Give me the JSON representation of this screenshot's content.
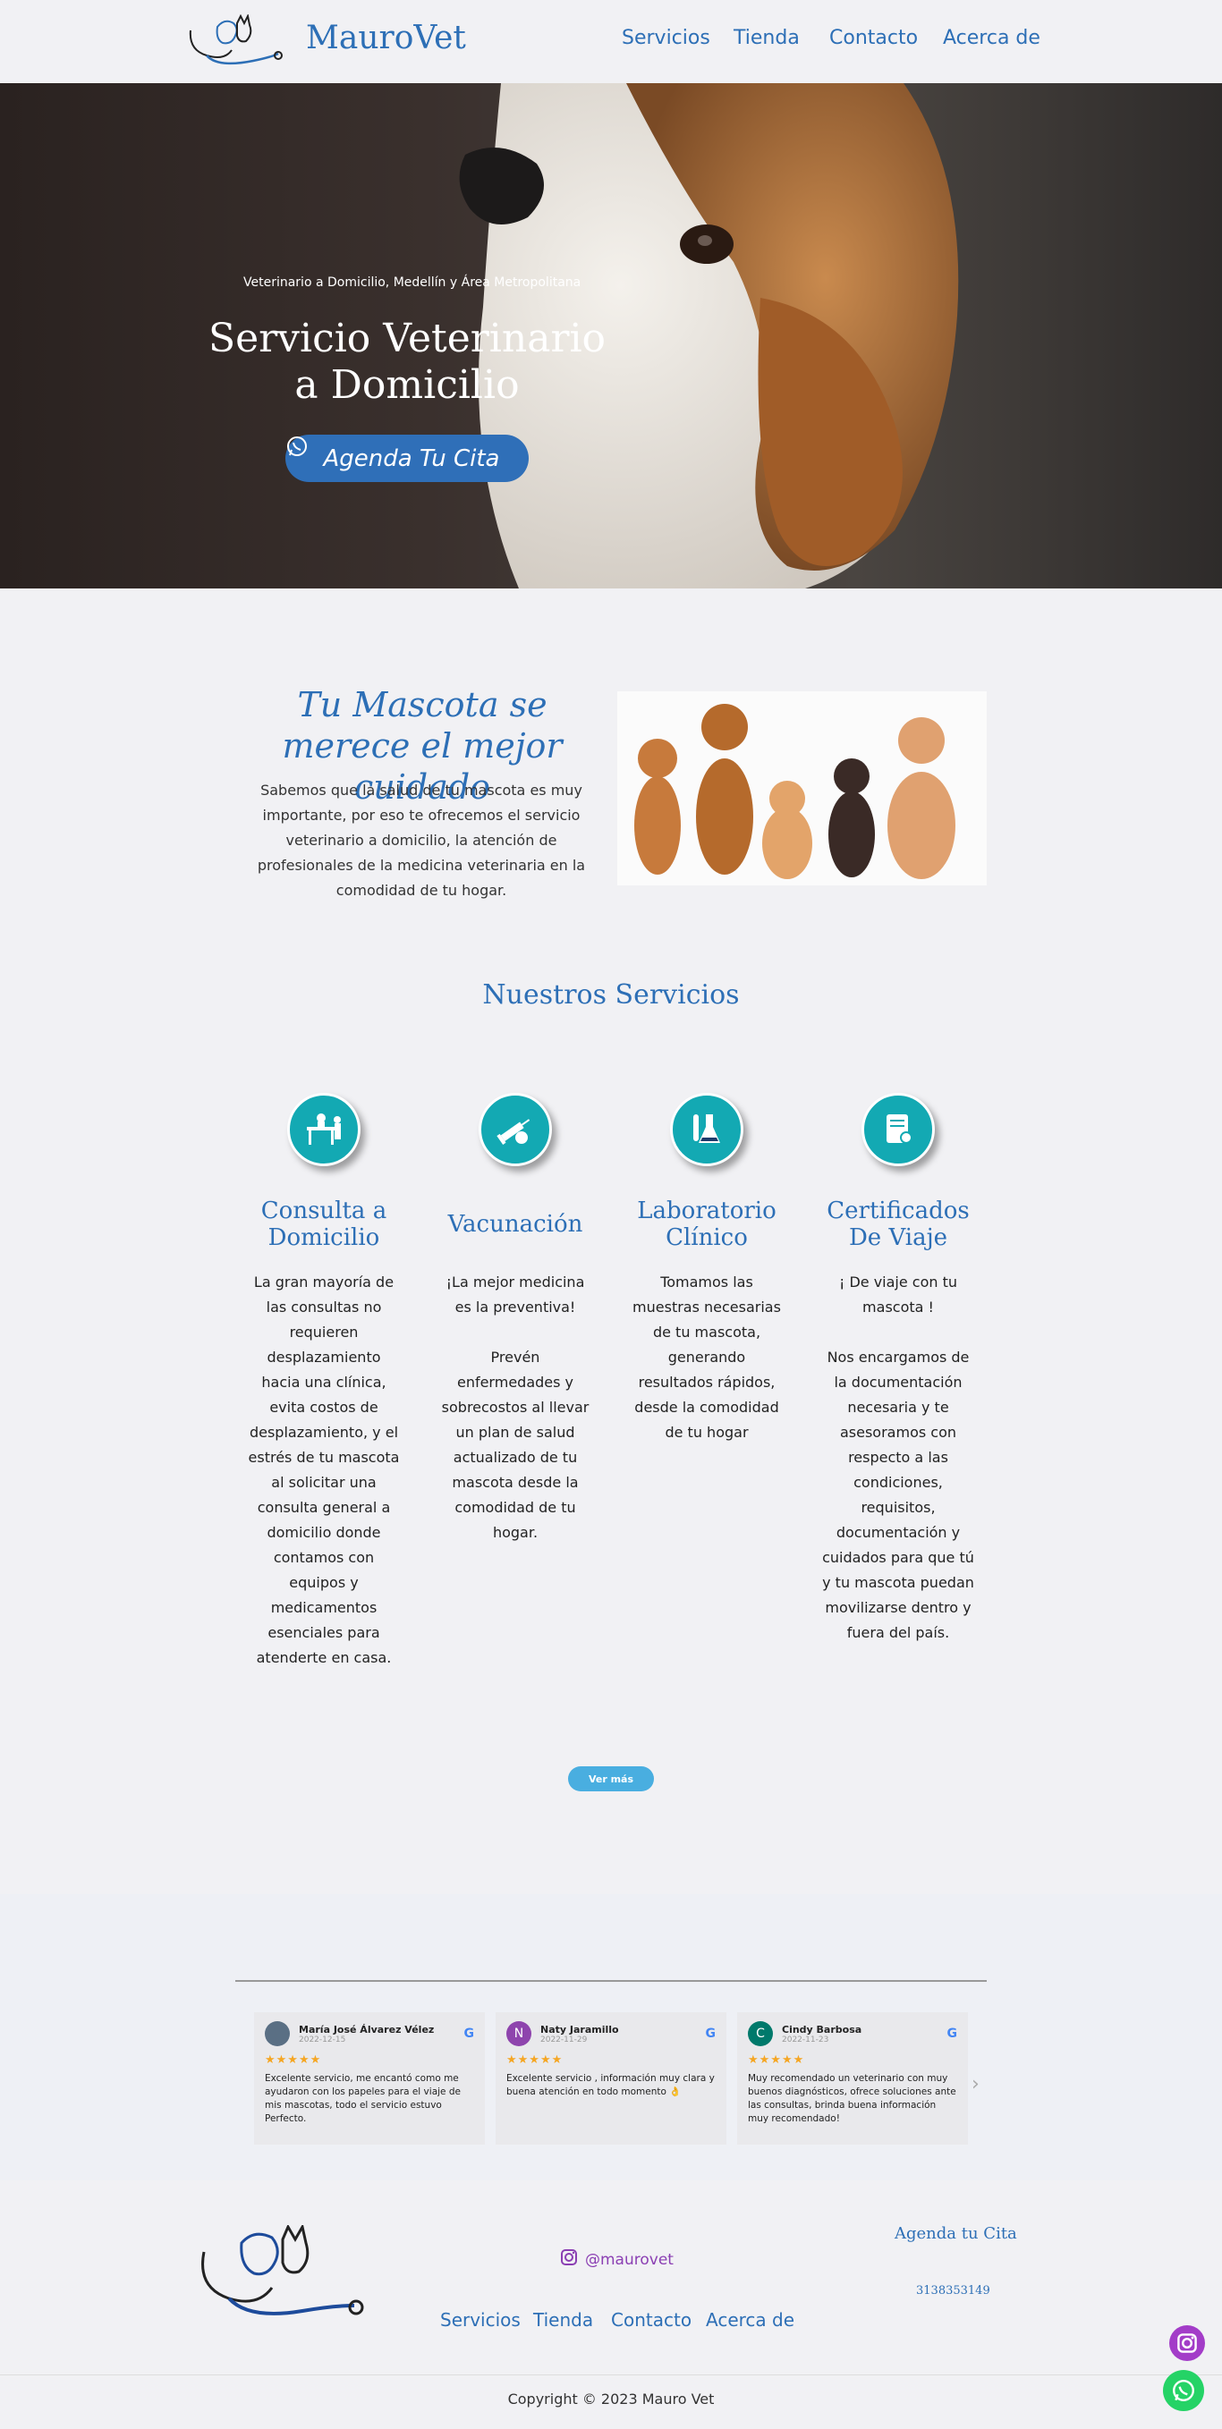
{
  "header": {
    "brand": "MauroVet",
    "nav": [
      "Servicios",
      "Tienda",
      "Contacto",
      "Acerca de"
    ]
  },
  "hero": {
    "subtitle": "Veterinario a Domicilio, Medellín y Área Metropolitana",
    "title": "Servicio Veterinario a Domicilio",
    "cta": "Agenda Tu Cita"
  },
  "intro": {
    "title": "Tu Mascota se merece el mejor cuidado",
    "text": "Sabemos que la salud de tu mascota es muy importante, por eso te ofrecemos el servicio veterinario a domicilio, la atención de profesionales de la medicina veterinaria en la comodidad de tu hogar."
  },
  "services": {
    "title": "Nuestros Servicios",
    "items": [
      {
        "icon": "vet-table-icon",
        "title": "Consulta a Domicilio",
        "text": "La gran mayoría de las consultas no requieren desplazamiento hacia una clínica, evita costos de desplazamiento, y el estrés de tu mascota al solicitar una consulta general a domicilio donde contamos con equipos y medicamentos esenciales para atenderte en casa."
      },
      {
        "icon": "syringe-icon",
        "title": "Vacunación",
        "text": "¡La mejor medicina es la preventiva!\n\nPrevén enfermedades y sobrecostos al llevar un plan de salud actualizado de tu mascota desde la comodidad de tu hogar."
      },
      {
        "icon": "flask-icon",
        "title": "Laboratorio Clínico",
        "text": "Tomamos las muestras necesarias de tu mascota, generando resultados rápidos, desde la comodidad de tu hogar"
      },
      {
        "icon": "certificate-icon",
        "title": "Certificados De Viaje",
        "text": "¡ De viaje con tu mascota !\n\nNos encargamos de la documentación necesaria y te asesoramos con respecto a las condiciones, requisitos, documentación y cuidados para que tú y tu mascota puedan movilizarse dentro y fuera del país."
      }
    ],
    "more": "Ver más"
  },
  "reviews": [
    {
      "name": "María José Álvarez Vélez",
      "date": "2022-12-15",
      "initial": "",
      "avatar_color": "#5a6f84",
      "stars": "★★★★★",
      "text": "Excelente servicio, me encantó como me ayudaron con los papeles para el viaje de mis mascotas, todo el servicio estuvo Perfecto."
    },
    {
      "name": "Naty Jaramillo",
      "date": "2022-11-29",
      "initial": "N",
      "avatar_color": "#8e44ad",
      "stars": "★★★★★",
      "text": "Excelente servicio , información muy clara y buena atención en todo momento 👌"
    },
    {
      "name": "Cindy Barbosa",
      "date": "2022-11-23",
      "initial": "C",
      "avatar_color": "#00796b",
      "stars": "★★★★★",
      "text": "Muy recomendado un veterinario con muy buenos diagnósticos, ofrece soluciones ante las consultas, brinda buena información muy recomendado!"
    }
  ],
  "footer": {
    "instagram": "@maurovet",
    "agenda": "Agenda tu Cita",
    "phone": "3138353149",
    "nav": [
      "Servicios",
      "Tienda",
      "Contacto",
      "Acerca de"
    ],
    "copyright": "Copyright © 2023 Mauro Vet"
  },
  "colors": {
    "accent": "#2d6fb6",
    "teal": "#13a9b3",
    "button": "#49aee0"
  }
}
